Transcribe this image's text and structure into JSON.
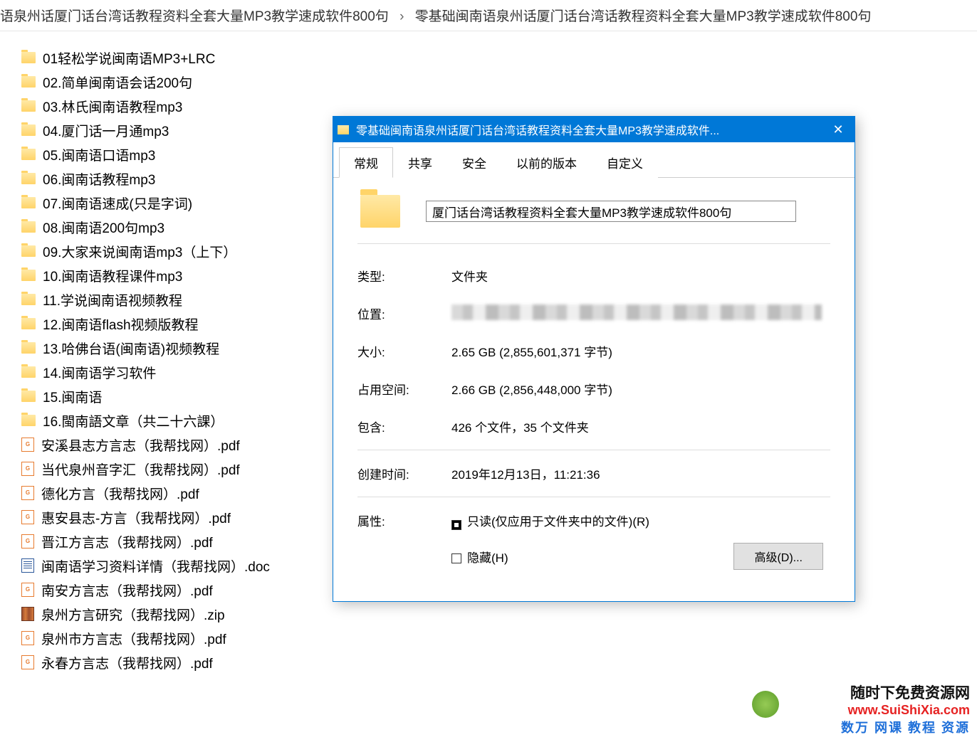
{
  "breadcrumb": {
    "seg1": "语泉州话厦门话台湾话教程资料全套大量MP3教学速成软件800句",
    "sep": "›",
    "seg2": "零基础闽南语泉州话厦门话台湾话教程资料全套大量MP3教学速成软件800句"
  },
  "files": [
    {
      "icon": "folder",
      "name": "01轻松学说闽南语MP3+LRC"
    },
    {
      "icon": "folder",
      "name": "02.简单闽南语会话200句"
    },
    {
      "icon": "folder",
      "name": "03.林氏闽南语教程mp3"
    },
    {
      "icon": "folder",
      "name": "04.厦门话一月通mp3"
    },
    {
      "icon": "folder",
      "name": "05.闽南语口语mp3"
    },
    {
      "icon": "folder",
      "name": "06.闽南话教程mp3"
    },
    {
      "icon": "folder",
      "name": "07.闽南语速成(只是字词)"
    },
    {
      "icon": "folder",
      "name": "08.闽南语200句mp3"
    },
    {
      "icon": "folder",
      "name": "09.大家来说闽南语mp3（上下）"
    },
    {
      "icon": "folder",
      "name": "10.闽南语教程课件mp3"
    },
    {
      "icon": "folder",
      "name": "11.学说闽南语视频教程"
    },
    {
      "icon": "folder",
      "name": "12.闽南语flash视频版教程"
    },
    {
      "icon": "folder",
      "name": "13.哈佛台语(闽南语)视频教程"
    },
    {
      "icon": "folder",
      "name": "14.闽南语学习软件"
    },
    {
      "icon": "folder",
      "name": "15.闽南语"
    },
    {
      "icon": "folder",
      "name": "16.閩南語文章（共二十六課）"
    },
    {
      "icon": "pdf",
      "name": "安溪县志方言志（我帮找网）.pdf"
    },
    {
      "icon": "pdf",
      "name": "当代泉州音字汇（我帮找网）.pdf"
    },
    {
      "icon": "pdf",
      "name": "德化方言（我帮找网）.pdf"
    },
    {
      "icon": "pdf",
      "name": "惠安县志-方言（我帮找网）.pdf"
    },
    {
      "icon": "pdf",
      "name": "晋江方言志（我帮找网）.pdf"
    },
    {
      "icon": "doc",
      "name": "闽南语学习资料详情（我帮找网）.doc"
    },
    {
      "icon": "pdf",
      "name": "南安方言志（我帮找网）.pdf"
    },
    {
      "icon": "zip",
      "name": "泉州方言研究（我帮找网）.zip"
    },
    {
      "icon": "pdf",
      "name": "泉州市方言志（我帮找网）.pdf"
    },
    {
      "icon": "pdf",
      "name": "永春方言志（我帮找网）.pdf"
    }
  ],
  "dialog": {
    "title": "零基础闽南语泉州话厦门话台湾话教程资料全套大量MP3教学速成软件...",
    "closeGlyph": "✕",
    "tabs": {
      "general": "常规",
      "share": "共享",
      "security": "安全",
      "previous": "以前的版本",
      "custom": "自定义"
    },
    "folderName": "厦门话台湾话教程资料全套大量MP3教学速成软件800句",
    "labels": {
      "type": "类型:",
      "location": "位置:",
      "size": "大小:",
      "sizeOnDisk": "占用空间:",
      "contains": "包含:",
      "created": "创建时间:",
      "attributes": "属性:"
    },
    "values": {
      "type": "文件夹",
      "size": "2.65 GB (2,855,601,371 字节)",
      "sizeOnDisk": "2.66 GB (2,856,448,000 字节)",
      "contains": "426 个文件，35 个文件夹",
      "created": "2019年12月13日，11:21:36",
      "readonly": "只读(仅应用于文件夹中的文件)(R)",
      "hidden": "隐藏(H)",
      "advanced": "高级(D)..."
    }
  },
  "watermark": {
    "l1": "随时下免费资源网",
    "l2": "www.SuiShiXia.com",
    "l3": "数万 网课 教程 资源"
  }
}
